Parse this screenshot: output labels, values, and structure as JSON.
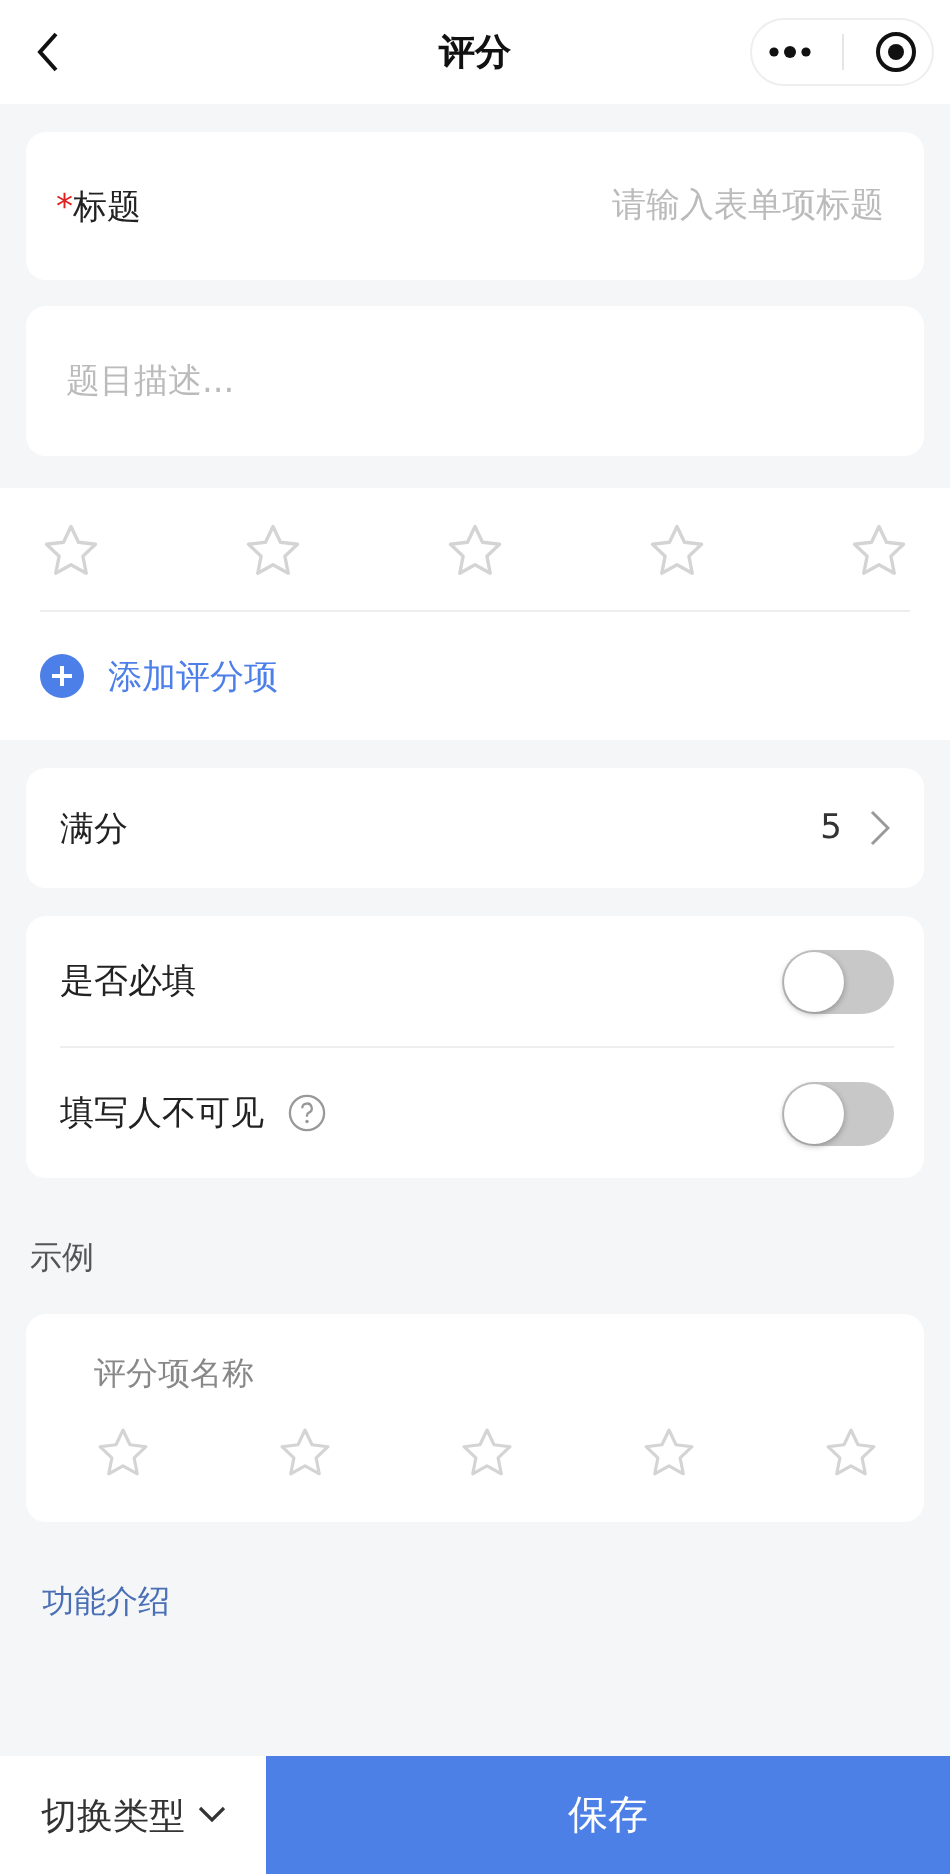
{
  "nav": {
    "title": "评分"
  },
  "title_field": {
    "required_mark": "*",
    "label": "标题",
    "placeholder": "请输入表单项标题"
  },
  "description": {
    "placeholder": "题目描述..."
  },
  "rating": {
    "stars": 0
  },
  "add_item": {
    "label": "添加评分项"
  },
  "full_score": {
    "label": "满分",
    "value": "5"
  },
  "toggles": [
    {
      "label": "是否必填",
      "on": false,
      "help": false
    },
    {
      "label": "填写人不可见",
      "on": false,
      "help": true
    }
  ],
  "example": {
    "heading": "示例",
    "name": "评分项名称",
    "stars": 0
  },
  "intro_link": "功能介绍",
  "footer": {
    "switch_type": "切换类型",
    "save": "保存"
  }
}
